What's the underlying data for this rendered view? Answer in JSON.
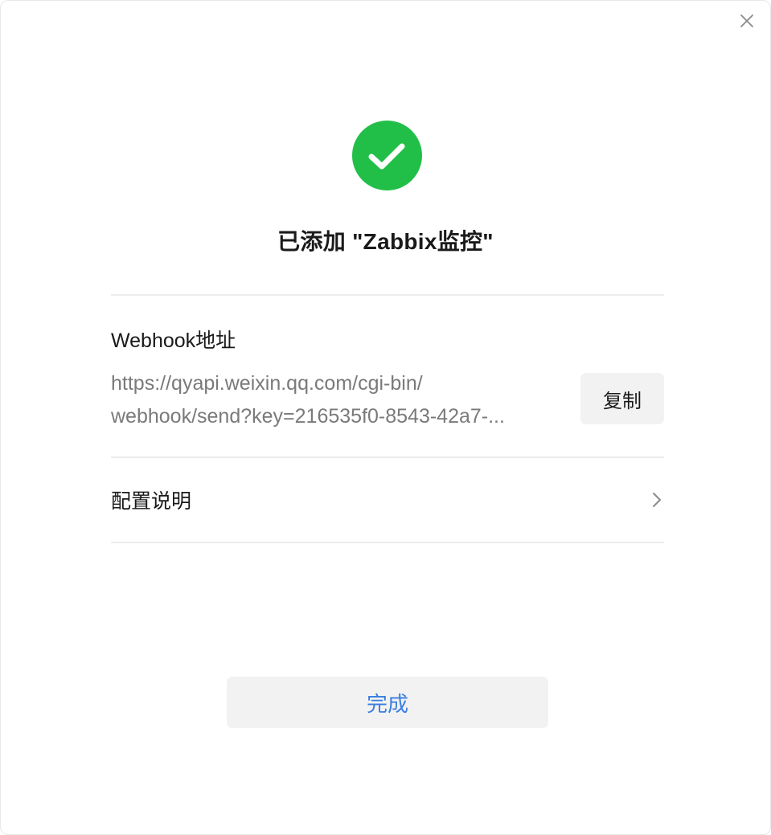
{
  "dialog": {
    "title": "已添加 \"Zabbix监控\"",
    "success_color": "#21bf48"
  },
  "webhook": {
    "label": "Webhook地址",
    "url_line1": "https://qyapi.weixin.qq.com/cgi-bin/",
    "url_line2": "webhook/send?key=216535f0-8543-42a7-...",
    "copy_label": "复制"
  },
  "config": {
    "label": "配置说明"
  },
  "footer": {
    "done_label": "完成",
    "done_color": "#3a7ee0"
  },
  "icons": {
    "close": "close-icon",
    "success": "check-circle-icon",
    "chevron": "chevron-right-icon"
  }
}
